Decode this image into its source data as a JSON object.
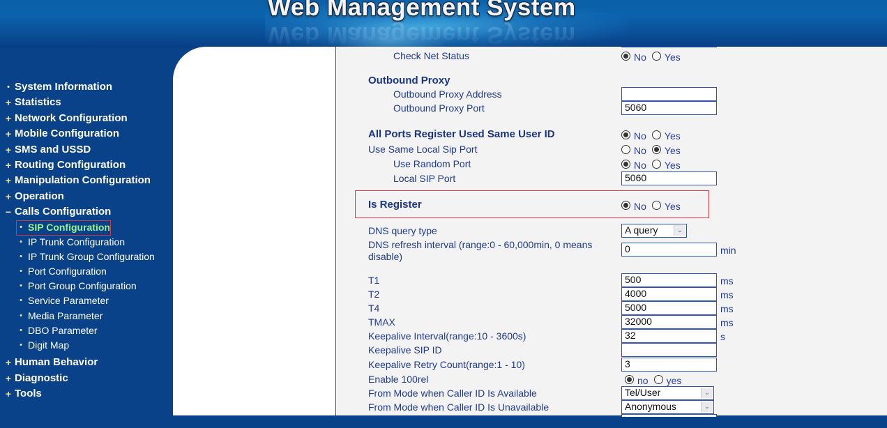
{
  "header": {
    "title": "Web Management System"
  },
  "sidebar": {
    "items": [
      {
        "label": "System Information",
        "marker": "•"
      },
      {
        "label": "Statistics",
        "marker": "+"
      },
      {
        "label": "Network Configuration",
        "marker": "+"
      },
      {
        "label": "Mobile Configuration",
        "marker": "+"
      },
      {
        "label": "SMS and USSD",
        "marker": "+"
      },
      {
        "label": "Routing Configuration",
        "marker": "+"
      },
      {
        "label": "Manipulation Configuration",
        "marker": "+"
      },
      {
        "label": "Operation",
        "marker": "+"
      },
      {
        "label": "Calls Configuration",
        "marker": "−"
      }
    ],
    "calls_sub_items": [
      {
        "label": "SIP Configuration",
        "active": true
      },
      {
        "label": "IP Trunk Configuration"
      },
      {
        "label": "IP Trunk Group Configuration"
      },
      {
        "label": "Port Configuration"
      },
      {
        "label": "Port Group Configuration"
      },
      {
        "label": "Service Parameter"
      },
      {
        "label": "Media Parameter"
      },
      {
        "label": "DBO Parameter"
      },
      {
        "label": "Digit Map"
      }
    ],
    "items_after": [
      {
        "label": "Human Behavior",
        "marker": "+"
      },
      {
        "label": "Diagnostic",
        "marker": "+"
      },
      {
        "label": "Tools",
        "marker": "+"
      }
    ],
    "sub_marker": "•"
  },
  "form": {
    "check_net_status": {
      "label": "Check Net Status",
      "options": [
        "No",
        "Yes"
      ],
      "selected": "No"
    },
    "outbound_proxy": {
      "heading": "Outbound Proxy",
      "address_label": "Outbound Proxy Address",
      "address_value": "",
      "port_label": "Outbound Proxy Port",
      "port_value": "5060"
    },
    "all_ports_same_user_id": {
      "label": "All Ports Register Used Same User ID",
      "options": [
        "No",
        "Yes"
      ],
      "selected": "No"
    },
    "use_same_local_sip_port": {
      "label": "Use Same Local Sip Port",
      "options": [
        "No",
        "Yes"
      ],
      "selected": "Yes"
    },
    "use_random_port": {
      "label": "Use Random Port",
      "options": [
        "No",
        "Yes"
      ],
      "selected": "No"
    },
    "local_sip_port": {
      "label": "Local SIP Port",
      "value": "5060"
    },
    "is_register": {
      "label": "Is Register",
      "options": [
        "No",
        "Yes"
      ],
      "selected": "No"
    },
    "dns_query_type": {
      "label": "DNS query type",
      "value": "A query"
    },
    "dns_refresh_interval": {
      "label_line1": "DNS refresh interval (range:0 - 60,000min, 0 means",
      "label_line2": "disable)",
      "value": "0",
      "unit": "min"
    },
    "t1": {
      "label": "T1",
      "value": "500",
      "unit": "ms"
    },
    "t2": {
      "label": "T2",
      "value": "4000",
      "unit": "ms"
    },
    "t4": {
      "label": "T4",
      "value": "5000",
      "unit": "ms"
    },
    "tmax": {
      "label": "TMAX",
      "value": "32000",
      "unit": "ms"
    },
    "keepalive_interval": {
      "label": "Keepalive Interval(range:10 - 3600s)",
      "value": "32",
      "unit": "s"
    },
    "keepalive_sip_id": {
      "label": "Keepalive SIP ID",
      "value": ""
    },
    "keepalive_retry_count": {
      "label": "Keepalive Retry Count(range:1 - 10)",
      "value": "3"
    },
    "enable_100rel": {
      "label": "Enable 100rel",
      "options": [
        "no",
        "yes"
      ],
      "selected": "no"
    },
    "from_mode_available": {
      "label": "From Mode when Caller ID Is Available",
      "value": "Tel/User"
    },
    "from_mode_unavailable": {
      "label": "From Mode when Caller ID Is Unavailable",
      "value": "Anonymous"
    }
  },
  "icons": {
    "dropdown_arrow": "⌄"
  }
}
